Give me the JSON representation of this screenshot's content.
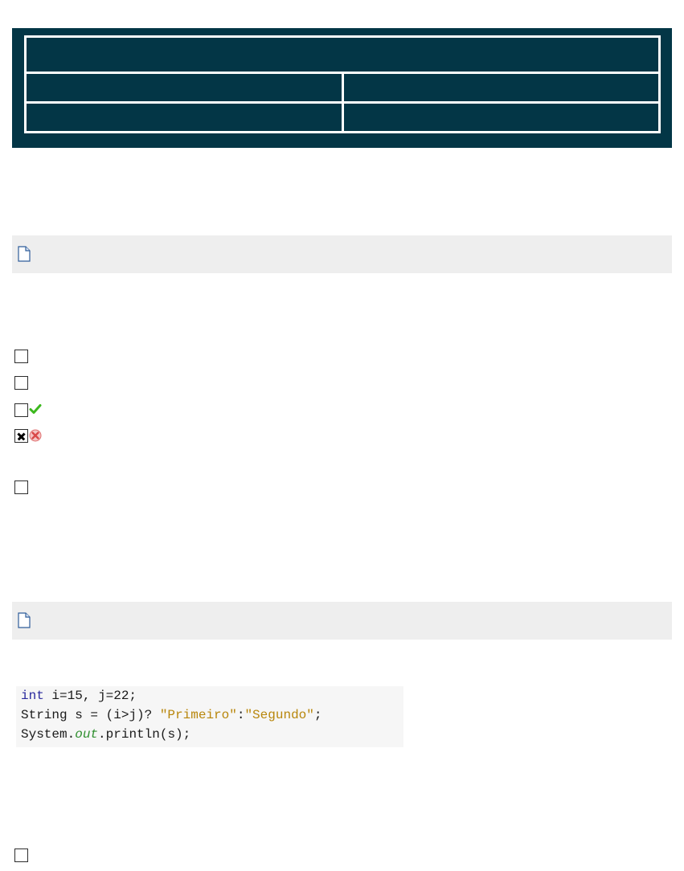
{
  "code": {
    "line1": {
      "keyword": "int",
      "rest": " i=15, j=22;"
    },
    "line2": {
      "pre": "String s = (i>j)? ",
      "str1": "\"Primeiro\"",
      "sep": ":",
      "str2": "\"Segundo\"",
      "end": ";"
    },
    "line3": {
      "pre": "System.",
      "field": "out",
      "post": ".println(s);"
    }
  },
  "questions": [
    {
      "icon": "document-icon"
    },
    {
      "icon": "document-icon"
    }
  ],
  "options": [
    {
      "checked": false,
      "status": null
    },
    {
      "checked": false,
      "status": null
    },
    {
      "checked": false,
      "status": "correct-check-icon"
    },
    {
      "checked": true,
      "status": "wrong-cross-icon"
    },
    {
      "checked": false,
      "status": null
    }
  ],
  "colors": {
    "header_bg": "#033646",
    "question_bar_bg": "#eeeeee",
    "correct": "#3cb81e",
    "wrong": "#e07070"
  }
}
